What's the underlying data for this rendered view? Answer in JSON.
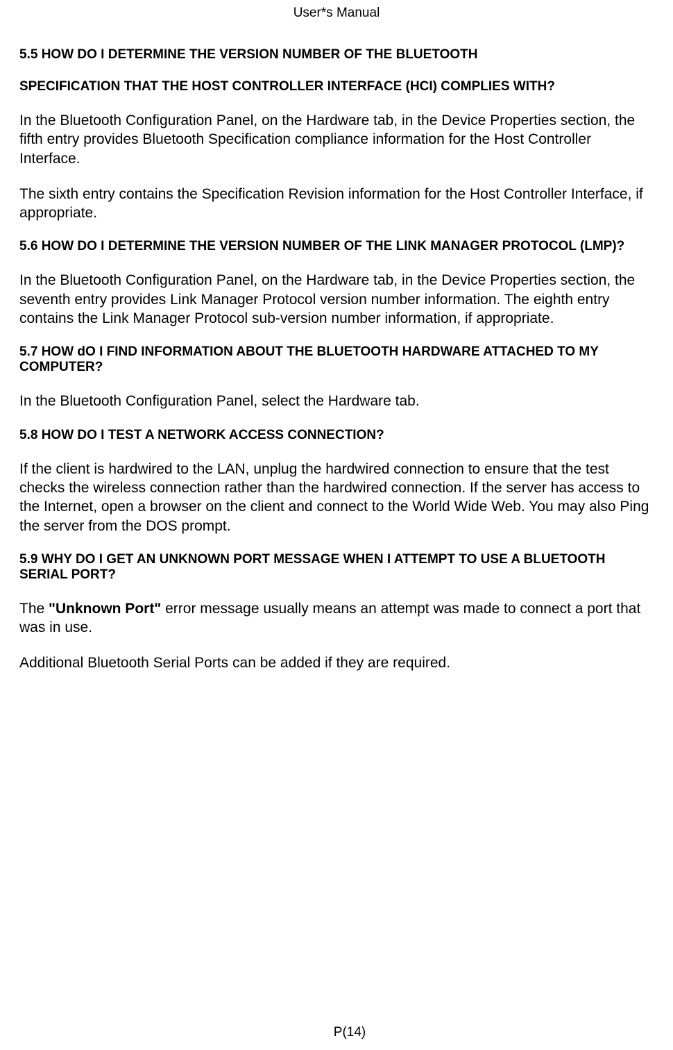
{
  "header": {
    "title": "User*s Manual"
  },
  "sections": {
    "s55": {
      "heading_line1": "5.5 HOW DO I DETERMINE THE VERSION NUMBER OF THE BLUETOOTH",
      "heading_line2": "SPECIFICATION THAT THE HOST CONTROLLER INTERFACE (HCI) COMPLIES WITH?",
      "para1": "In the Bluetooth Configuration Panel, on the Hardware tab, in the Device Properties section, the fifth entry provides Bluetooth Specification compliance information for the Host Controller Interface.",
      "para2": "The sixth entry contains the Specification Revision information for the Host Controller Interface, if appropriate."
    },
    "s56": {
      "heading_line1": "5.6 HOW DO I DETERMINE THE VERSION NUMBER OF THE LINK MANAGER PROTOCOL (LMP)?",
      "para1": "In the Bluetooth Configuration Panel, on the Hardware tab, in the Device Properties section, the seventh entry provides Link Manager Protocol version number information. The eighth entry contains the Link Manager Protocol sub-version number information, if appropriate."
    },
    "s57": {
      "heading_line1": "5.7 HOW dO I FIND INFORMATION ABOUT THE BLUETOOTH HARDWARE ATTACHED TO MY COMPUTER?",
      "para1": "In the Bluetooth Configuration Panel, select the Hardware tab."
    },
    "s58": {
      "heading_line1": "5.8 HOW DO I TEST A NETWORK ACCESS CONNECTION?",
      "para1": "If the client is hardwired to the LAN, unplug the hardwired connection to ensure that the test checks the wireless connection rather than the hardwired connection. If the server has access to the Internet, open a browser on the client and connect to the World Wide Web. You may also Ping the server from the DOS prompt."
    },
    "s59": {
      "heading_line1": "5.9 WHY DO I GET AN UNKNOWN PORT MESSAGE WHEN I ATTEMPT TO USE A BLUETOOTH SERIAL PORT?",
      "para1_prefix": "The ",
      "para1_bold": "\"Unknown Port\"",
      "para1_suffix": " error message usually means an attempt was made to connect a port that was in use.",
      "para2": "Additional Bluetooth Serial Ports can be added if they are required."
    }
  },
  "footer": {
    "page": "　　P(14)"
  }
}
